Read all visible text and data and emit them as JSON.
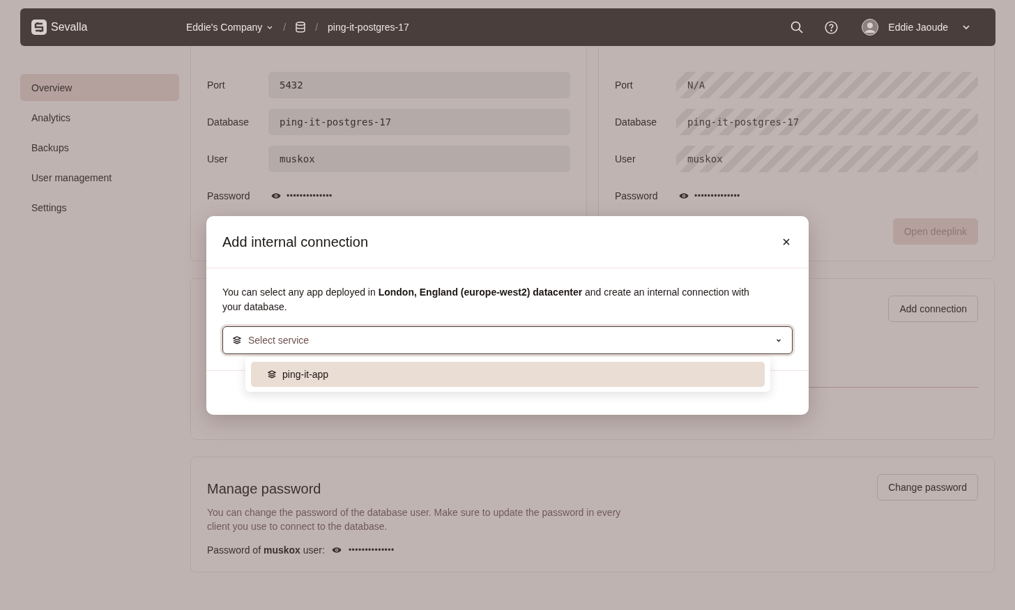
{
  "topbar": {
    "brand": "Sevalla",
    "company": "Eddie's Company",
    "separator_1": "/",
    "separator_2": "/",
    "resource": "ping-it-postgres-17",
    "user": "Eddie Jaoude"
  },
  "sidebar": {
    "items": [
      {
        "label": "Overview",
        "selected": true
      },
      {
        "label": "Analytics",
        "selected": false
      },
      {
        "label": "Backups",
        "selected": false
      },
      {
        "label": "User management",
        "selected": false
      },
      {
        "label": "Settings",
        "selected": false
      }
    ]
  },
  "connection_cards": [
    {
      "disabled": false,
      "fields": [
        {
          "kind": "text",
          "label": "Port",
          "value": "5432"
        },
        {
          "kind": "text",
          "label": "Database",
          "value": "ping-it-postgres-17"
        },
        {
          "kind": "text",
          "label": "User",
          "value": "muskox"
        },
        {
          "kind": "password",
          "label": "Password",
          "value": "••••••••••••••"
        }
      ]
    },
    {
      "disabled": true,
      "fields": [
        {
          "kind": "text",
          "label": "Port",
          "value": "N/A"
        },
        {
          "kind": "text",
          "label": "Database",
          "value": "ping-it-postgres-17"
        },
        {
          "kind": "text",
          "label": "User",
          "value": "muskox"
        },
        {
          "kind": "password",
          "label": "Password",
          "value": "••••••••••••••"
        }
      ],
      "button": {
        "label": "Open deeplink",
        "disabled": true
      }
    }
  ],
  "internal_connections": {
    "button": "Add connection"
  },
  "manage_password": {
    "title": "Manage password",
    "description": "You can change the password of the database user. Make sure to update the password in every client you use to connect to the database.",
    "password_label": "Password of **muskox** user:",
    "password_value": "••••••••••••••",
    "button": "Change password"
  },
  "modal": {
    "title": "Add internal connection",
    "text": "You can select any app deployed in **London, England (europe-west2) datacenter** and create an internal connection with your database.",
    "select": {
      "placeholder": "Select service",
      "expanded": true,
      "options": [
        {
          "label": "ping-it-app",
          "selected": true
        }
      ]
    }
  }
}
